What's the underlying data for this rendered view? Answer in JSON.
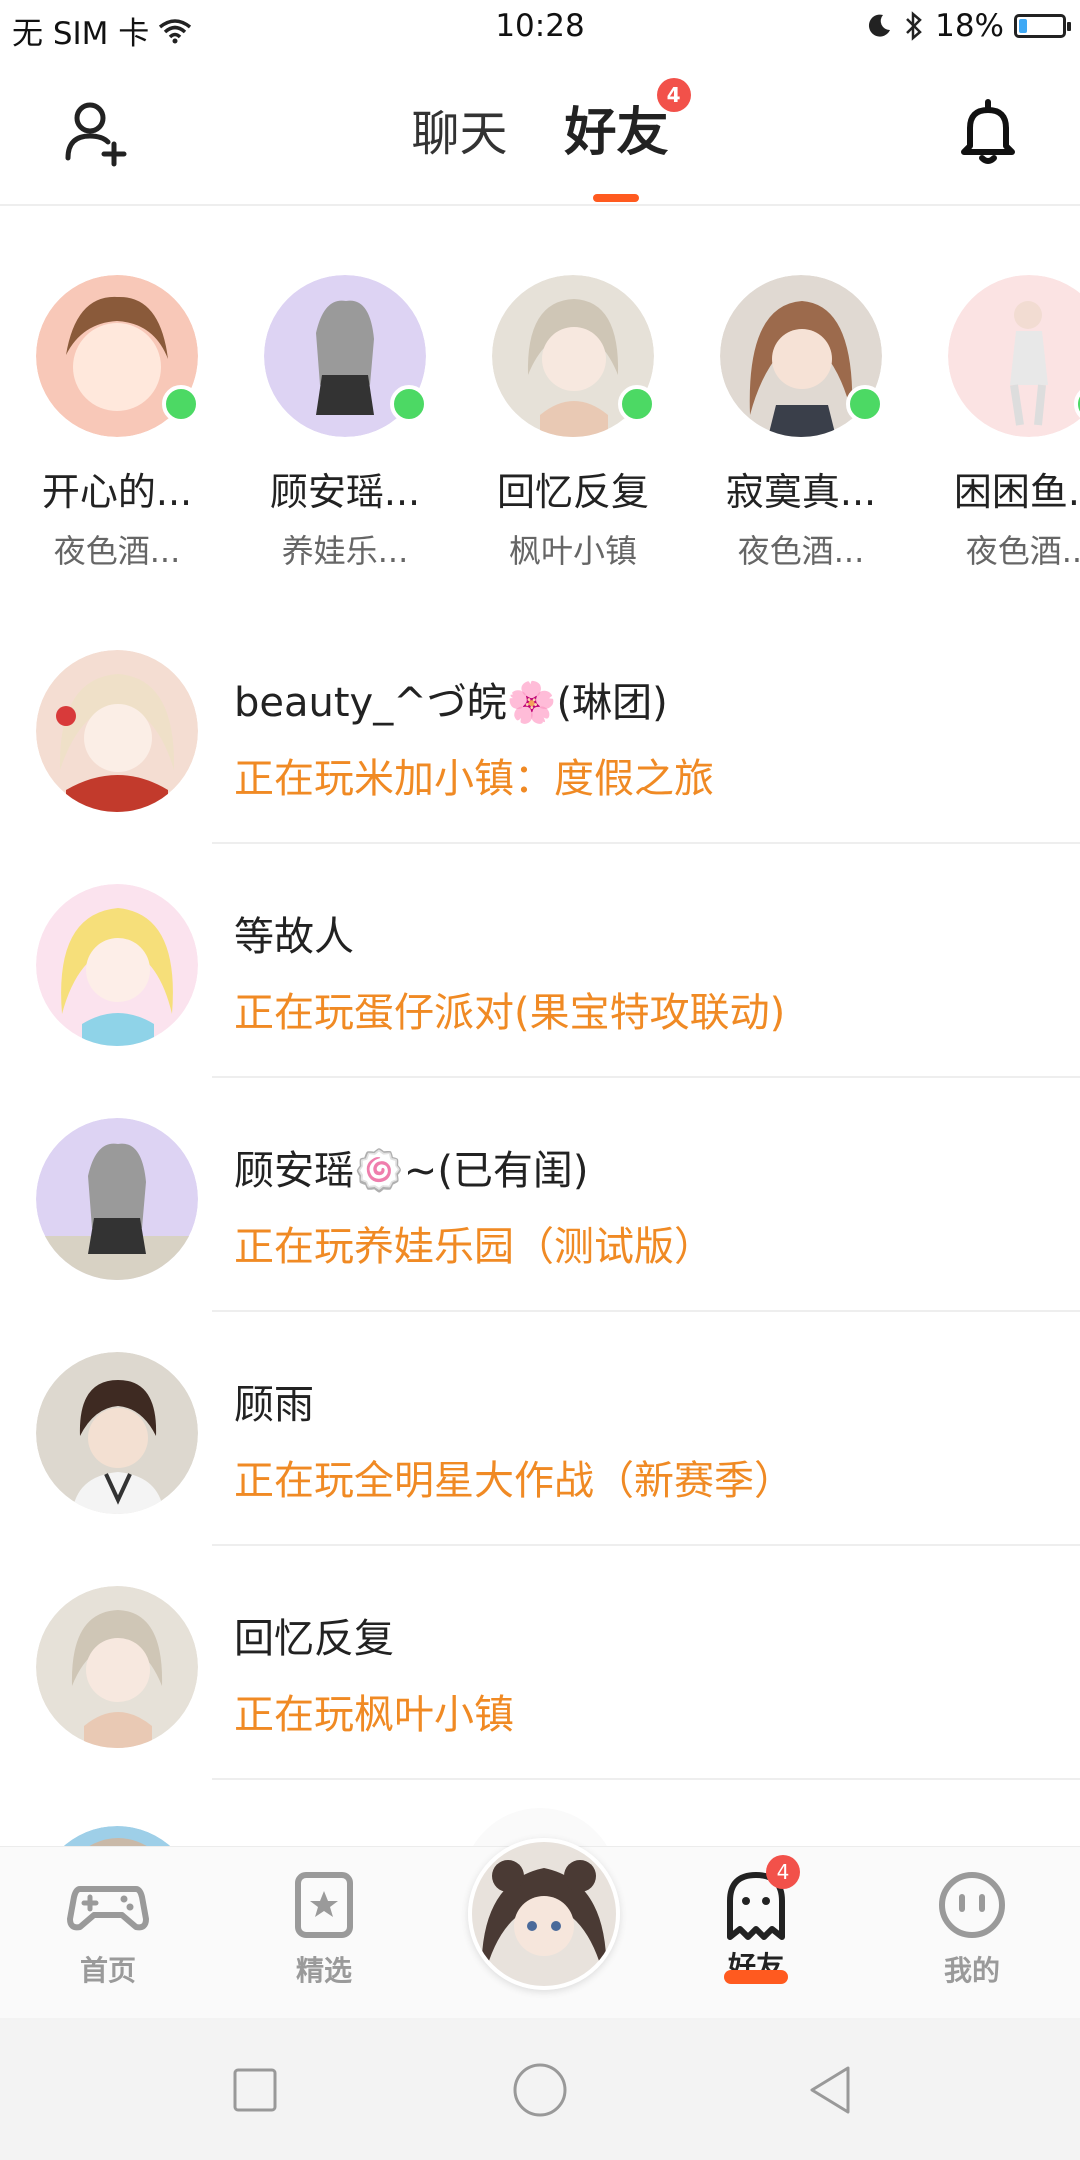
{
  "status_bar": {
    "carrier": "无 SIM 卡",
    "time": "10:28",
    "battery_percent": "18%",
    "battery_level": 0.18
  },
  "header": {
    "tabs": [
      {
        "label": "聊天",
        "active": false
      },
      {
        "label": "好友",
        "active": true,
        "badge": "4"
      }
    ],
    "icons": {
      "left": "add-friend-icon",
      "right": "bell-icon"
    }
  },
  "online_friends": [
    {
      "name": "开心的...",
      "game": "夜色酒...",
      "online": true,
      "avatar_color": "#f8c8b8"
    },
    {
      "name": "顾安瑶...",
      "game": "养娃乐...",
      "online": true,
      "avatar_color": "#ddd3f3"
    },
    {
      "name": "回忆反复",
      "game": "枫叶小镇",
      "online": true,
      "avatar_color": "#e6e1d8"
    },
    {
      "name": "寂寞真...",
      "game": "夜色酒...",
      "online": true,
      "avatar_color": "#e0d9d2"
    },
    {
      "name": "困困鱼...",
      "game": "夜色酒...",
      "online": true,
      "avatar_color": "#fbe3e3"
    }
  ],
  "friends": [
    {
      "name": "beauty_^づ皖🌸(琳团)",
      "status": "正在玩米加小镇：度假之旅",
      "avatar_color": "#f4ddd2"
    },
    {
      "name": "等故人",
      "status": "正在玩蛋仔派对(果宝特攻联动)",
      "avatar_color": "#fbe3ee"
    },
    {
      "name": "顾安瑶🍥~(已有闺)",
      "status": "正在玩养娃乐园（测试版）",
      "avatar_color": "#ddd3f3"
    },
    {
      "name": "顾雨",
      "status": "正在玩全明星大作战（新赛季）",
      "avatar_color": "#ddd8cf"
    },
    {
      "name": "回忆反复",
      "status": "正在玩枫叶小镇",
      "avatar_color": "#e6e1d8"
    }
  ],
  "bottom_nav": [
    {
      "label": "首页",
      "icon": "gamepad-icon",
      "active": false
    },
    {
      "label": "精选",
      "icon": "star-bookmark-icon",
      "active": false
    },
    {
      "label": "",
      "icon": "center-avatar",
      "active": false
    },
    {
      "label": "好友",
      "icon": "ghost-icon",
      "active": true,
      "badge": "4"
    },
    {
      "label": "我的",
      "icon": "face-icon",
      "active": false
    }
  ],
  "colors": {
    "accent": "#ff5a1f",
    "status_text": "#f08a24",
    "online_dot": "#4cd964",
    "badge": "#f2514a"
  }
}
